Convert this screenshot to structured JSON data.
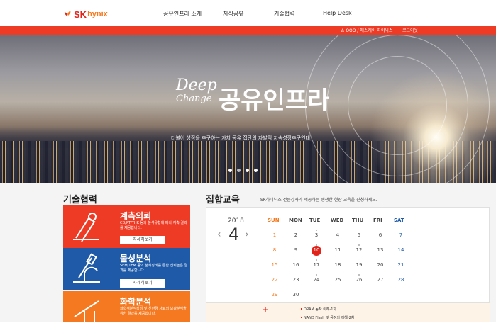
{
  "header": {
    "logo_sk": "SK",
    "logo_hynix": "hynix",
    "nav": [
      "공유인프라 소개",
      "지식공유",
      "기술협력",
      "Help Desk"
    ]
  },
  "userbar": {
    "user_text": "OOO / 에스케이 하이닉스",
    "logout": "로그아웃"
  },
  "hero": {
    "title_en": "Deep",
    "title_en_sub": "Change",
    "title_ko": "공유인프라",
    "caption": "더불어 성장을 추구하는 가치 공유 집단의 자발적 지속성장추구연대",
    "dots": 4,
    "active_dot": 1
  },
  "tech": {
    "heading": "기술협력",
    "cards": [
      {
        "title": "계측의뢰",
        "desc": "CD/PT/THK 등의 분석유형에 따라 계측 결과를 제공합니다.",
        "button": "자세히보기",
        "color": "#ed3b25",
        "icon": "microscope-icon"
      },
      {
        "title": "물성분석",
        "desc": "SEM/TEM 등의 분석장비를 통한 신뢰높은 결과를 제공합니다.",
        "button": "자세히보기",
        "color": "#1e5aa8",
        "icon": "microscope-icon"
      },
      {
        "title": "화학분석",
        "desc": "화학적분석장비 및 친환경 재료의 보광분석을 위한 결과를 제공합니다.",
        "button": "",
        "color": "#f47920",
        "icon": "chemistry-icon"
      }
    ]
  },
  "education": {
    "heading": "집합교육",
    "desc": "SK하이닉스 전문강사가 제공하는 생생한 현장 교육을 신청하세요.",
    "calendar": {
      "year": "2018",
      "month": "4",
      "prev": "‹",
      "next": "›",
      "weekdays": [
        "SUN",
        "MON",
        "TUE",
        "WED",
        "THU",
        "FRI",
        "SAT"
      ],
      "weeks": [
        [
          "1",
          "2",
          "3",
          "4",
          "5",
          "6",
          "7"
        ],
        [
          "8",
          "9",
          "10",
          "11",
          "12",
          "13",
          "14"
        ],
        [
          "15",
          "16",
          "17",
          "18",
          "19",
          "20",
          "21"
        ],
        [
          "22",
          "23",
          "24",
          "25",
          "26",
          "27",
          "28"
        ],
        [
          "29",
          "30",
          "",
          "",
          "",
          "",
          ""
        ]
      ],
      "today": "10",
      "sun_color": "#f47920",
      "sat_color": "#1e5aa8"
    },
    "list": {
      "plus": "+",
      "items": [
        "DRAM 동작 이해-1차",
        "NAND Flash 및 공정의 이해-2차"
      ]
    }
  }
}
